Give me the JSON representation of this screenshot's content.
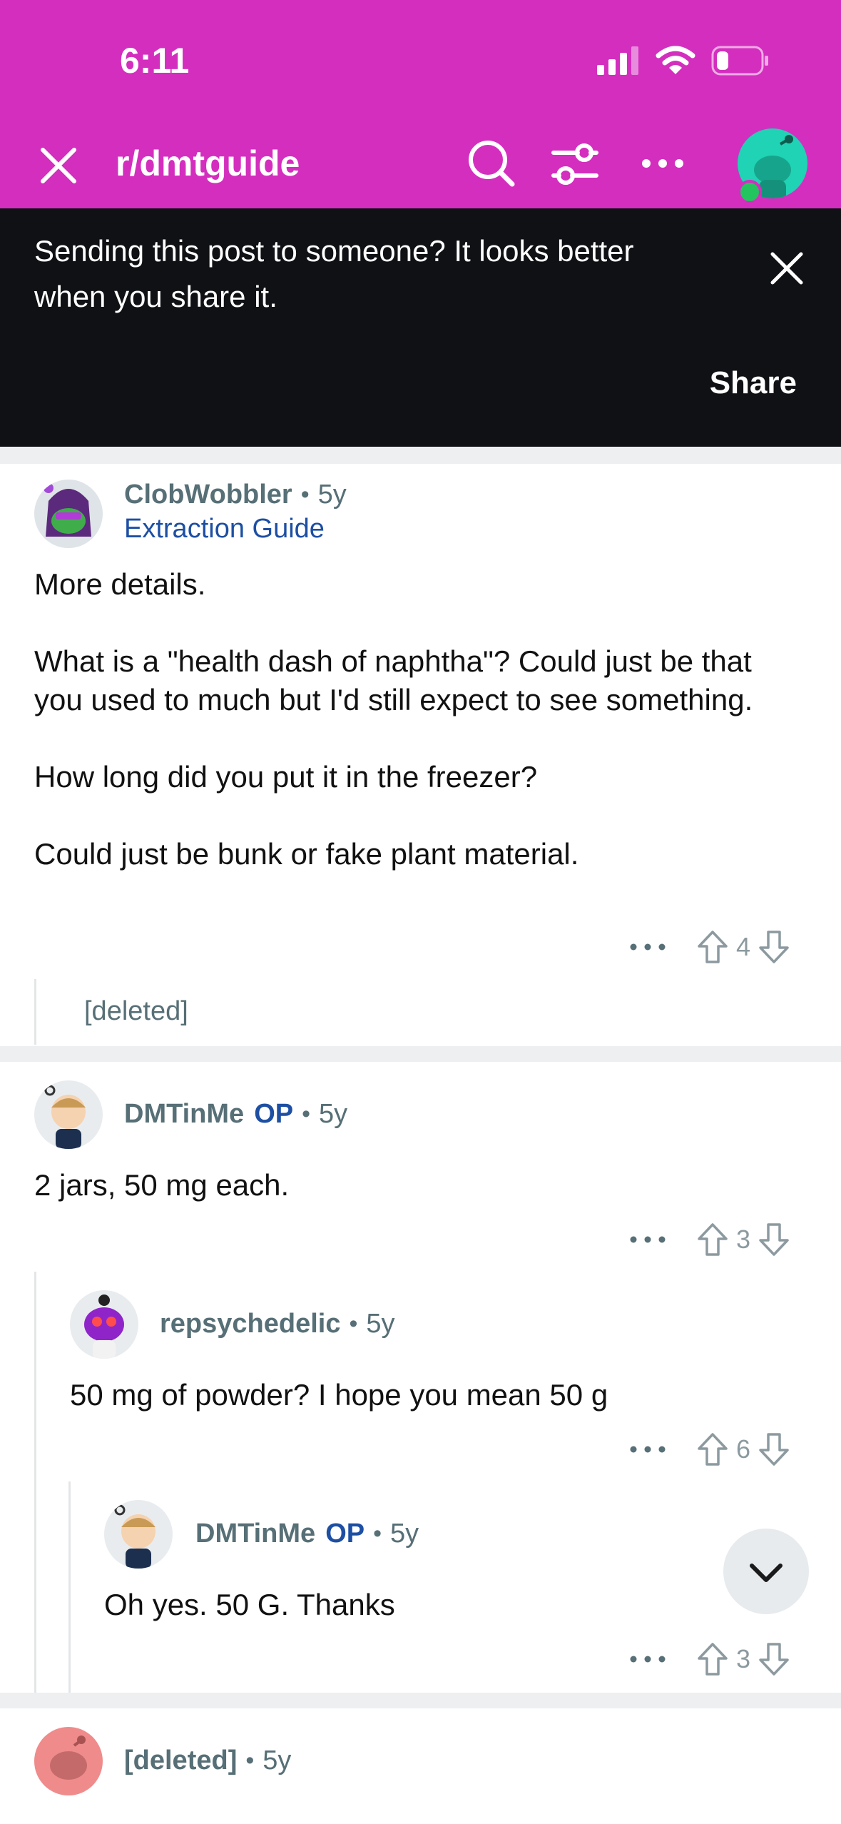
{
  "status_bar": {
    "time": "6:11"
  },
  "nav": {
    "subreddit": "r/dmtguide"
  },
  "banner": {
    "message": "Sending this post to someone? It looks better when you share it.",
    "share_label": "Share"
  },
  "comments": [
    {
      "user": "ClobWobbler",
      "age": "5y",
      "flair": "Extraction Guide",
      "body": "More details.\n\nWhat is a \"health dash of naphtha\"? Could just be that you used to much but I'd still expect to see something.\n\nHow long did you put it in the freezer?\n\nCould just be bunk or fake plant material.",
      "votes": "4"
    },
    {
      "deleted_label": "[deleted]"
    },
    {
      "user": "DMTinMe",
      "op_badge": "OP",
      "age": "5y",
      "body": "2 jars, 50 mg each.",
      "votes": "3"
    },
    {
      "user": "repsychedelic",
      "age": "5y",
      "body": "50 mg of powder? I hope you mean 50 g",
      "votes": "6"
    },
    {
      "user": "DMTinMe",
      "op_badge": "OP",
      "age": "5y",
      "body": "Oh yes. 50 G. Thanks",
      "votes": "3"
    },
    {
      "user": "[deleted]",
      "age": "5y"
    }
  ],
  "colors": {
    "header": "#d42ebf",
    "banner": "#0f1114",
    "link": "#1d4fa3"
  }
}
